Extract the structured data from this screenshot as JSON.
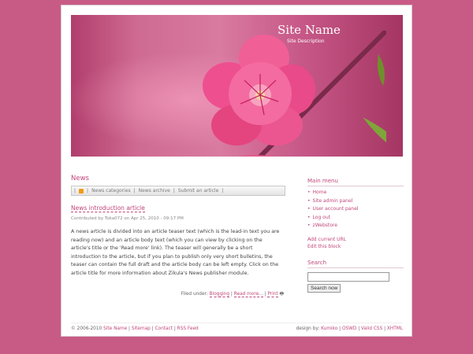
{
  "header": {
    "site_name": "Site Name",
    "site_description": "Site Description"
  },
  "main": {
    "section_title": "News",
    "subnav": [
      "News categories",
      "News archive",
      "Submit an article"
    ],
    "article": {
      "title": "News introduction article",
      "meta": "Contributed by Toka072 on Apr 25, 2010 - 09:17 PM",
      "body": "A news article is divided into an article teaser text (which is the lead-in text you are reading now) and an article body text (which you can view by clicking on the article's title or the 'Read more' link). The teaser will generally be a short introduction to the article, but if you plan to publish only very short bulletins, the teaser can contain the full draft and the article body can be left empty. Click on the article title for more information about Zikula's News publisher module.",
      "filed_label": "Filed under:",
      "filed_links": [
        "Blogging",
        "Read more...",
        "Print"
      ]
    }
  },
  "sidebar": {
    "main_menu_title": "Main menu",
    "menu_items": [
      "Home",
      "Site admin panel",
      "User account panel",
      "Log out",
      "zWebstore"
    ],
    "add_url": "Add current URL",
    "edit_block": "Edit this block",
    "search_title": "Search",
    "search_button": "Search now"
  },
  "footer": {
    "left_prefix": "© 2006-2010",
    "site_name": "Site Name",
    "links": [
      "Sitemap",
      "Contact",
      "RSS Feed"
    ],
    "right_prefix": "design by:",
    "designer": "Kumiko",
    "right_links": [
      "OSWD",
      "Valid CSS",
      "XHTML"
    ]
  },
  "colors": {
    "background": "#c85b86",
    "accent": "#c0477a"
  }
}
